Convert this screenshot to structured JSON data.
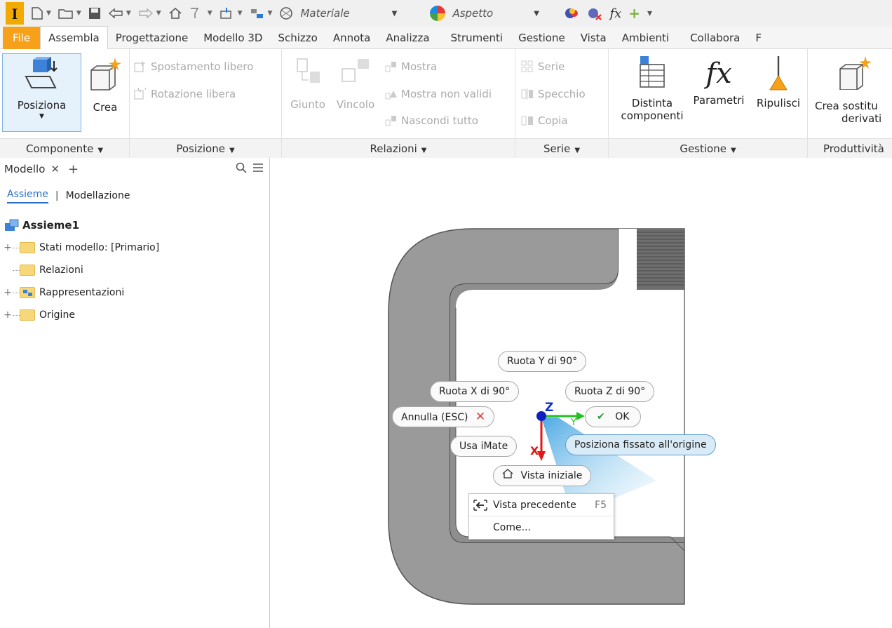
{
  "qat": {
    "logo": "I",
    "material_placeholder": "Materiale",
    "appearance_placeholder": "Aspetto"
  },
  "tabs": [
    "File",
    "Assembla",
    "Progettazione",
    "Modello 3D",
    "Schizzo",
    "Annota",
    "Analizza",
    "Strumenti",
    "Gestione",
    "Vista",
    "Ambienti",
    "Collabora",
    "F"
  ],
  "ribbon": {
    "componente": {
      "title": "Componente",
      "posiziona": "Posiziona",
      "crea": "Crea"
    },
    "posizione": {
      "title": "Posizione",
      "spostamento": "Spostamento libero",
      "rotazione": "Rotazione libera"
    },
    "relazioni": {
      "title": "Relazioni",
      "giunto": "Giunto",
      "vincolo": "Vincolo",
      "mostra": "Mostra",
      "mostra_non_validi": "Mostra non validi",
      "nascondi_tutto": "Nascondi tutto"
    },
    "serie": {
      "title": "Serie",
      "serie": "Serie",
      "specchio": "Specchio",
      "copia": "Copia"
    },
    "gestione": {
      "title": "Gestione",
      "distinta_1": "Distinta",
      "distinta_2": "componenti",
      "parametri": "Parametri",
      "ripulisci": "Ripulisci"
    },
    "produttivita": {
      "title": "Produttività",
      "crea_1": "Crea sostitu",
      "crea_2": "derivati"
    }
  },
  "browser": {
    "tab_label": "Modello",
    "sub_tabs": [
      "Assieme",
      "Modellazione"
    ],
    "root": "Assieme1",
    "items": [
      "Stati modello: [Primario]",
      "Relazioni",
      "Rappresentazioni",
      "Origine"
    ]
  },
  "viewport": {
    "ruota_y": "Ruota Y di 90°",
    "ruota_x": "Ruota X di 90°",
    "ruota_z": "Ruota Z di 90°",
    "annulla": "Annulla (ESC)",
    "ok": "OK",
    "usa_imate": "Usa iMate",
    "posiziona_fissato": "Posiziona fissato all'origine",
    "vista_iniziale": "Vista iniziale",
    "axis_x": "X",
    "axis_y": "Y",
    "axis_z": "Z",
    "menu": {
      "vista_precedente": "Vista precedente",
      "shortcut": "F5",
      "come": "Come..."
    }
  }
}
